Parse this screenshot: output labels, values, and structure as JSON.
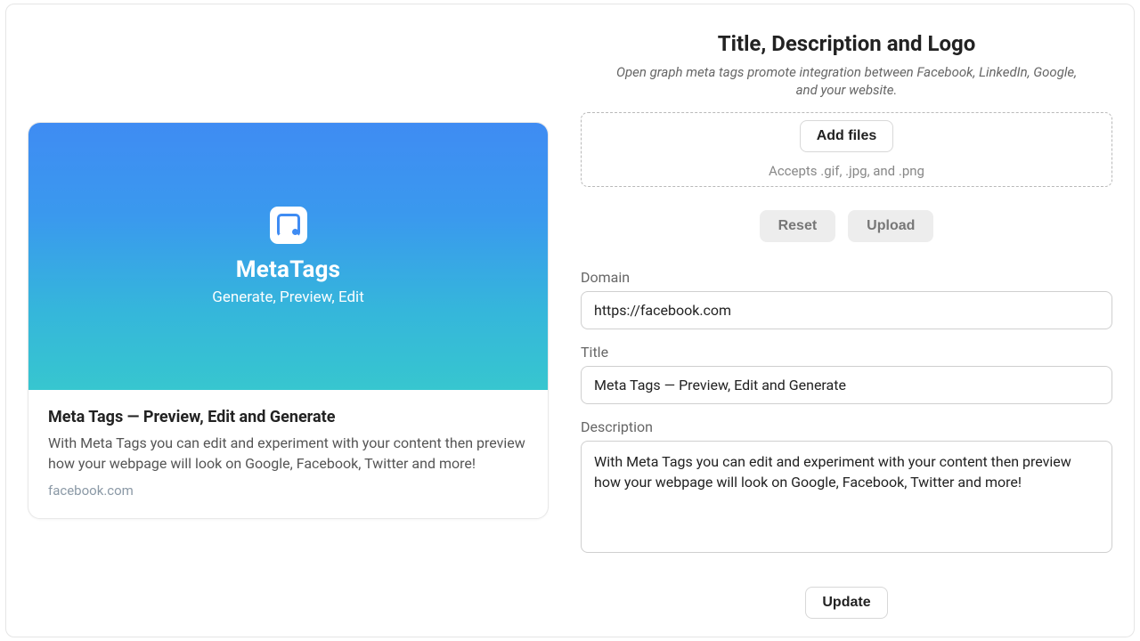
{
  "right": {
    "heading": "Title, Description and Logo",
    "subheading": "Open graph meta tags promote integration between Facebook, LinkedIn, Google, and your website.",
    "dropzone": {
      "add_files_label": "Add files",
      "accepts_text": "Accepts .gif, .jpg, and .png"
    },
    "buttons": {
      "reset": "Reset",
      "upload": "Upload",
      "update": "Update"
    },
    "fields": {
      "domain_label": "Domain",
      "domain_value": "https://facebook.com",
      "title_label": "Title",
      "title_value": "Meta Tags — Preview, Edit and Generate",
      "description_label": "Description",
      "description_value": "With Meta Tags you can edit and experiment with your content then preview how your webpage will look on Google, Facebook, Twitter and more!"
    }
  },
  "preview": {
    "hero_brand": "MetaTags",
    "hero_tagline": "Generate, Preview, Edit",
    "title": "Meta Tags — Preview, Edit and Generate",
    "description": "With Meta Tags you can edit and experiment with your content then preview how your webpage will look on Google, Facebook, Twitter and more!",
    "domain": "facebook.com"
  }
}
